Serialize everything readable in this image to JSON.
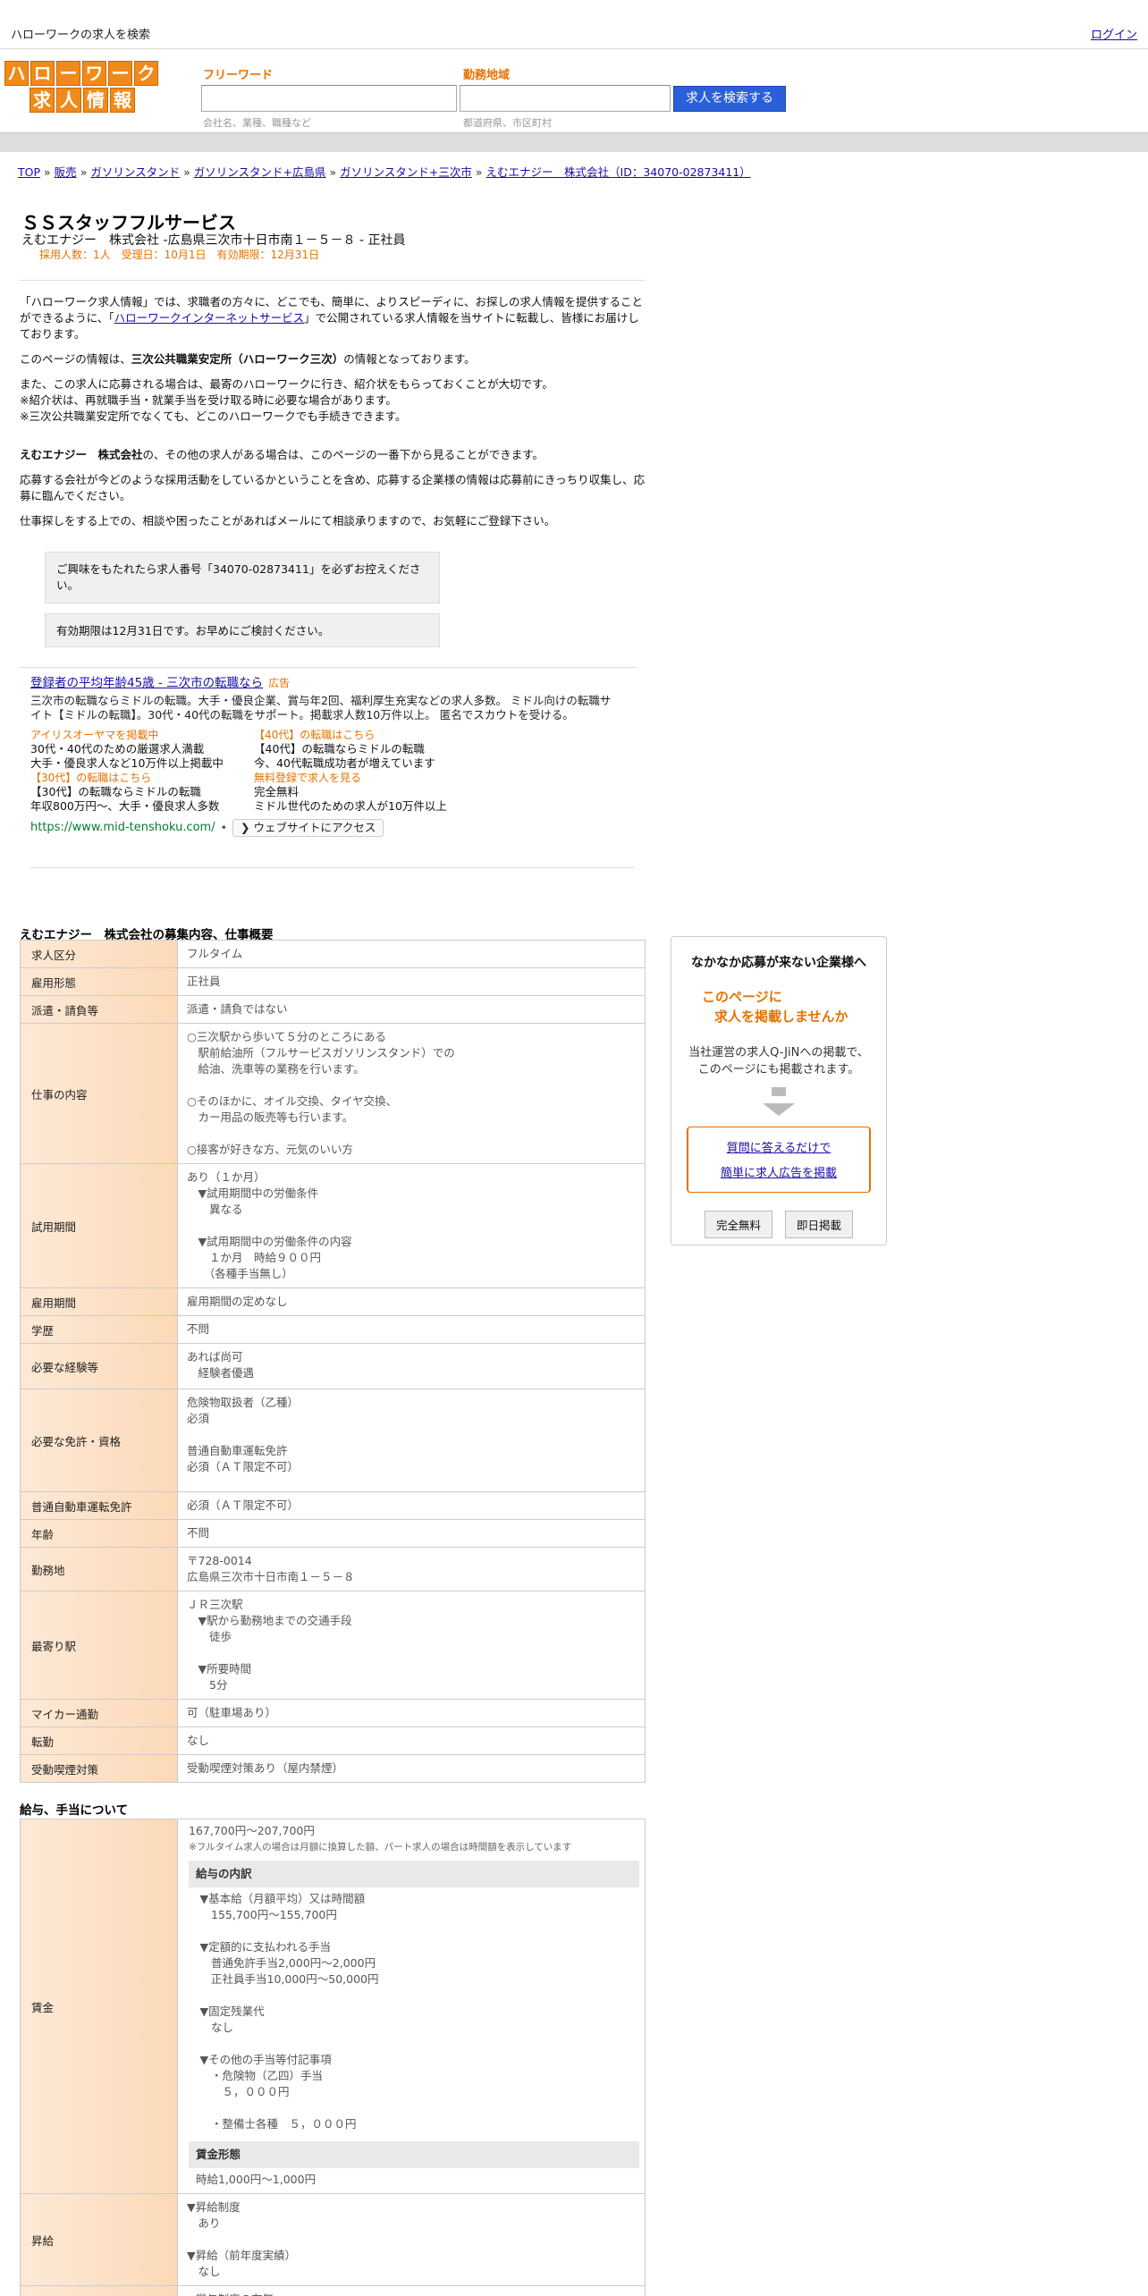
{
  "topbar": {
    "site_title": "ハローワークの求人を検索",
    "login": "ログイン"
  },
  "logo": {
    "row1": [
      "ハ",
      "ロ",
      "ー",
      "ワ",
      "ー",
      "ク"
    ],
    "row2": [
      "求",
      "人",
      "情",
      "報"
    ]
  },
  "search": {
    "freeword_label": "フリーワード",
    "freeword_placeholder": "会社名、業種、職種など",
    "area_label": "勤務地域",
    "area_placeholder": "都道府県、市区町村",
    "button": "求人を検索する"
  },
  "breadcrumb": [
    "TOP",
    "販売",
    "ガソリンスタンド",
    "ガソリンスタンド+広島県",
    "ガソリンスタンド+三次市",
    "えむエナジー　株式会社（ID：34070-02873411）"
  ],
  "breadcrumb_sep": "»",
  "job": {
    "title": "ＳＳスタッフフルサービス",
    "company_line": "えむエナジー　株式会社 -広島県三次市十日市南１－５－８ - 正社員",
    "meta": "採用人数：1人　受理日：10月1日　有効期限：12月31日"
  },
  "intro": {
    "p1_a": "「ハローワーク求人情報」では、求職者の方々に、どこでも、簡単に、よりスピーディに、お探しの求人情報を提供することができるように、「",
    "p1_link": "ハローワークインターネットサービス",
    "p1_b": "」で公開されている求人情報を当サイトに転載し、皆様にお届けしております。",
    "p2_a": "このページの情報は、",
    "p2_bold": "三次公共職業安定所（ハローワーク三次）",
    "p2_b": "の情報となっております。",
    "p3_l1": "また、この求人に応募される場合は、最寄のハローワークに行き、紹介状をもらっておくことが大切です。",
    "p3_l2": "※紹介状は、再就職手当・就業手当を受け取る時に必要な場合があります。",
    "p3_l3": "※三次公共職業安定所でなくても、どこのハローワークでも手続きできます。",
    "p4_bold": "えむエナジー　株式会社",
    "p4_b": "の、その他の求人がある場合は、このページの一番下から見ることができます。",
    "p5": "応募する会社が今どのような採用活動をしているかということを含め、応募する企業様の情報は応募前にきっちり収集し、応募に臨んでください。",
    "p6": "仕事探しをする上での、相談や困ったことがあればメールにて相談承りますので、お気軽にご登録下さい。"
  },
  "notices": {
    "n1": "ご興味をもたれたら求人番号「34070-02873411」を必ずお控えください。",
    "n2": "有効期限は12月31日です。お早めにご検討ください。"
  },
  "ad": {
    "headline": "登録者の平均年齢45歳 - 三次市の転職なら",
    "tag": "広告",
    "desc": "三次市の転職ならミドルの転職。大手・優良企業、賞与年2回、福利厚生充実などの求人多数。 ミドル向けの転職サイト【ミドルの転職】。30代・40代の転職をサポート。掲載求人数10万件以上。 匿名でスカウトを受ける。",
    "sitelinks": [
      {
        "title": "アイリスオーヤマを掲載中",
        "l1": "30代・40代のための厳選求人満載",
        "l2": "大手・優良求人など10万件以上掲載中"
      },
      {
        "title": "【40代】の転職はこちら",
        "l1": "【40代】の転職ならミドルの転職",
        "l2": "今、40代転職成功者が増えています"
      },
      {
        "title": "【30代】の転職はこちら",
        "l1": "【30代】の転職ならミドルの転職",
        "l2": "年収800万円～、大手・優良求人多数"
      },
      {
        "title": "無料登録で求人を見る",
        "l1": "完全無料",
        "l2": "ミドル世代のための求人が10万件以上"
      }
    ],
    "url": "https://www.mid-tenshoku.com/",
    "visit": "ウェブサイトにアクセス"
  },
  "detail_heading": "えむエナジー　株式会社の募集内容、仕事概要",
  "detail_rows": [
    {
      "label": "求人区分",
      "value": "フルタイム"
    },
    {
      "label": "雇用形態",
      "value": "正社員"
    },
    {
      "label": "派遣・請負等",
      "value": "派遣・請負ではない"
    },
    {
      "label": "仕事の内容",
      "value": "○三次駅から歩いて５分のところにある\n　駅前給油所（フルサービスガソリンスタンド）での\n　給油、洗車等の業務を行います。\n\n○そのほかに、オイル交換、タイヤ交換、\n　カー用品の販売等も行います。\n\n○接客が好きな方、元気のいい方"
    },
    {
      "label": "試用期間",
      "value": "あり（１か月）\n　▼試用期間中の労働条件\n　　異なる\n\n　▼試用期間中の労働条件の内容\n　　１か月　時給９００円\n　　（各種手当無し）"
    },
    {
      "label": "雇用期間",
      "value": "雇用期間の定めなし"
    },
    {
      "label": "学歴",
      "value": "不問"
    },
    {
      "label": "必要な経験等",
      "value": "あれば尚可\n　経験者優遇"
    },
    {
      "label": "必要な免許・資格",
      "value": "危険物取扱者（乙種）\n必須\n\n普通自動車運転免許\n必須（ＡＴ限定不可）"
    },
    {
      "label": "普通自動車運転免許",
      "value": "必須（ＡＴ限定不可）"
    },
    {
      "label": "年齢",
      "value": "不問"
    },
    {
      "label": "勤務地",
      "value": "〒728-0014\n広島県三次市十日市南１－５－８"
    },
    {
      "label": "最寄り駅",
      "value": "ＪＲ三次駅\n　▼駅から勤務地までの交通手段\n　　徒歩\n\n　▼所要時間\n　　5分"
    },
    {
      "label": "マイカー通勤",
      "value": "可（駐車場あり）"
    },
    {
      "label": "転勤",
      "value": "なし"
    },
    {
      "label": "受動喫煙対策",
      "value": "受動喫煙対策あり（屋内禁煙）"
    }
  ],
  "wage_heading": "給与、手当について",
  "wage": {
    "label": "賃金",
    "range": "167,700円〜207,700円",
    "note": "※フルタイム求人の場合は月額に換算した額、パート求人の場合は時間額を表示しています",
    "breakdown_title": "給与の内訳",
    "breakdown": "　▼基本給（月額平均）又は時間額\n　　155,700円〜155,700円\n\n　▼定額的に支払われる手当\n　　普通免許手当2,000円〜2,000円\n　　正社員手当10,000円〜50,000円\n\n　▼固定残業代\n　　なし\n\n　▼その他の手当等付記事項\n　　・危険物（乙四）手当\n　　　５，０００円\n\n　　・整備士各種　５，０００円",
    "form_title": "賃金形態",
    "form": "時給1,000円〜1,000円"
  },
  "raise": {
    "label": "昇給",
    "value": "▼昇給制度\n　あり\n\n▼昇給（前年度実績）\n　なし"
  },
  "bonus": {
    "label": "",
    "value": "▼賞与制度の有無\n　あり"
  },
  "promo": {
    "title": "なかなか応募が来ない企業様へ",
    "orange_l1": "このページに",
    "orange_l2": "求人を掲載しませんか",
    "text_l1": "当社運営の求人Q-JiNへの掲載で、",
    "text_l2": "このページにも掲載されます。",
    "link1": "質問に答えるだけで",
    "link2": "簡単に求人広告を掲載",
    "btn1": "完全無料",
    "btn2": "即日掲載"
  }
}
